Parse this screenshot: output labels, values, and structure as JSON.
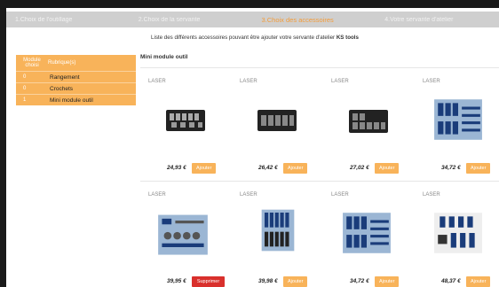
{
  "top_strip": [
    "",
    "",
    "",
    ""
  ],
  "steps": [
    {
      "label": "1.Choix de l'outillage"
    },
    {
      "label": "2.Choix de la servante"
    },
    {
      "label": "3.Choix des accessoires"
    },
    {
      "label": "4.Votre servante d'atelier"
    }
  ],
  "intro": {
    "text": "Liste des différents accessoires pouvant être ajouter votre servante d'atelier ",
    "brand": "KS tools"
  },
  "sidebar": {
    "header_module": "Module choisi",
    "header_rubrique": "Rubrique(s)",
    "items": [
      {
        "num": "0",
        "label": "Rangement"
      },
      {
        "num": "0",
        "label": "Crochets"
      },
      {
        "num": "1",
        "label": "Mini module outil"
      }
    ]
  },
  "section_title": "Mini module outil",
  "products": [
    {
      "brand": "LASER",
      "price": "24,93 €",
      "button": "Ajouter"
    },
    {
      "brand": "LASER",
      "price": "26,42 €",
      "button": "Ajouter"
    },
    {
      "brand": "LASER",
      "price": "27,02 €",
      "button": "Ajouter"
    },
    {
      "brand": "LASER",
      "price": "34,72 €",
      "button": "Ajouter"
    },
    {
      "brand": "LASER",
      "price": "39,95 €",
      "button": "Supprimer"
    },
    {
      "brand": "LASER",
      "price": "39,98 €",
      "button": "Ajouter"
    },
    {
      "brand": "LASER",
      "price": "34,72 €",
      "button": "Ajouter"
    },
    {
      "brand": "LASER",
      "price": "48,37 €",
      "button": "Ajouter"
    }
  ],
  "colors": {
    "accent": "#f8b35a",
    "active_step": "#f39c3a",
    "delete": "#d9302c"
  }
}
